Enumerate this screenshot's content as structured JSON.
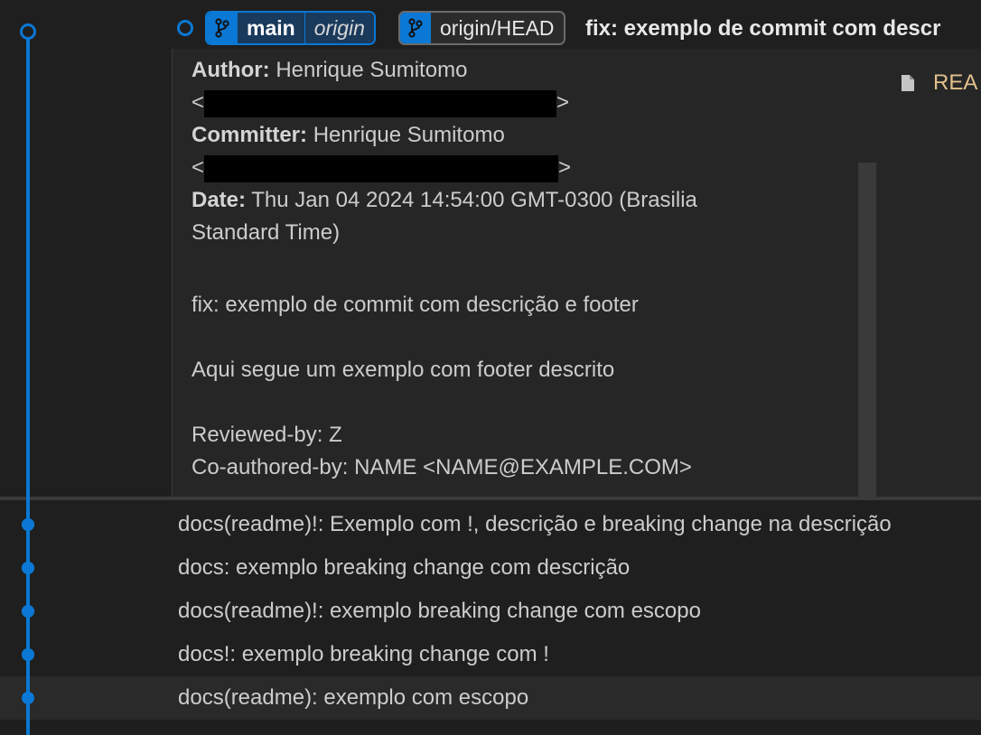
{
  "head_commit": {
    "refs": {
      "local_branch": "main",
      "local_remote": "origin",
      "remote_ref": "origin/HEAD"
    },
    "title": "fix: exemplo de commit com descr"
  },
  "details": {
    "author_label": "Author:",
    "author_name": "Henrique Sumitomo",
    "committer_label": "Committer:",
    "committer_name": "Henrique Sumitomo",
    "email_open": "<",
    "email_close": ">",
    "date_label": "Date:",
    "date_value_1": "Thu Jan 04 2024 14:54:00 GMT-0300 (Brasilia",
    "date_value_2": "Standard Time)",
    "message_subject": "fix: exemplo de commit com descrição e footer",
    "message_body": "Aqui segue um exemplo com footer descrito",
    "trailer_1": "Reviewed-by: Z",
    "trailer_2": "Co-authored-by: NAME <NAME@EXAMPLE.COM>"
  },
  "files": [
    {
      "name": "REA",
      "icon": "file-icon"
    }
  ],
  "commits": [
    {
      "message": "docs(readme)!: Exemplo com !, descrição e breaking change na descrição"
    },
    {
      "message": "docs: exemplo breaking change com descrição"
    },
    {
      "message": "docs(readme)!: exemplo breaking change com escopo"
    },
    {
      "message": "docs!: exemplo breaking change com !"
    },
    {
      "message": "docs(readme): exemplo com escopo"
    }
  ],
  "colors": {
    "graph": "#0a78d4",
    "file_modified": "#e2c08d"
  }
}
